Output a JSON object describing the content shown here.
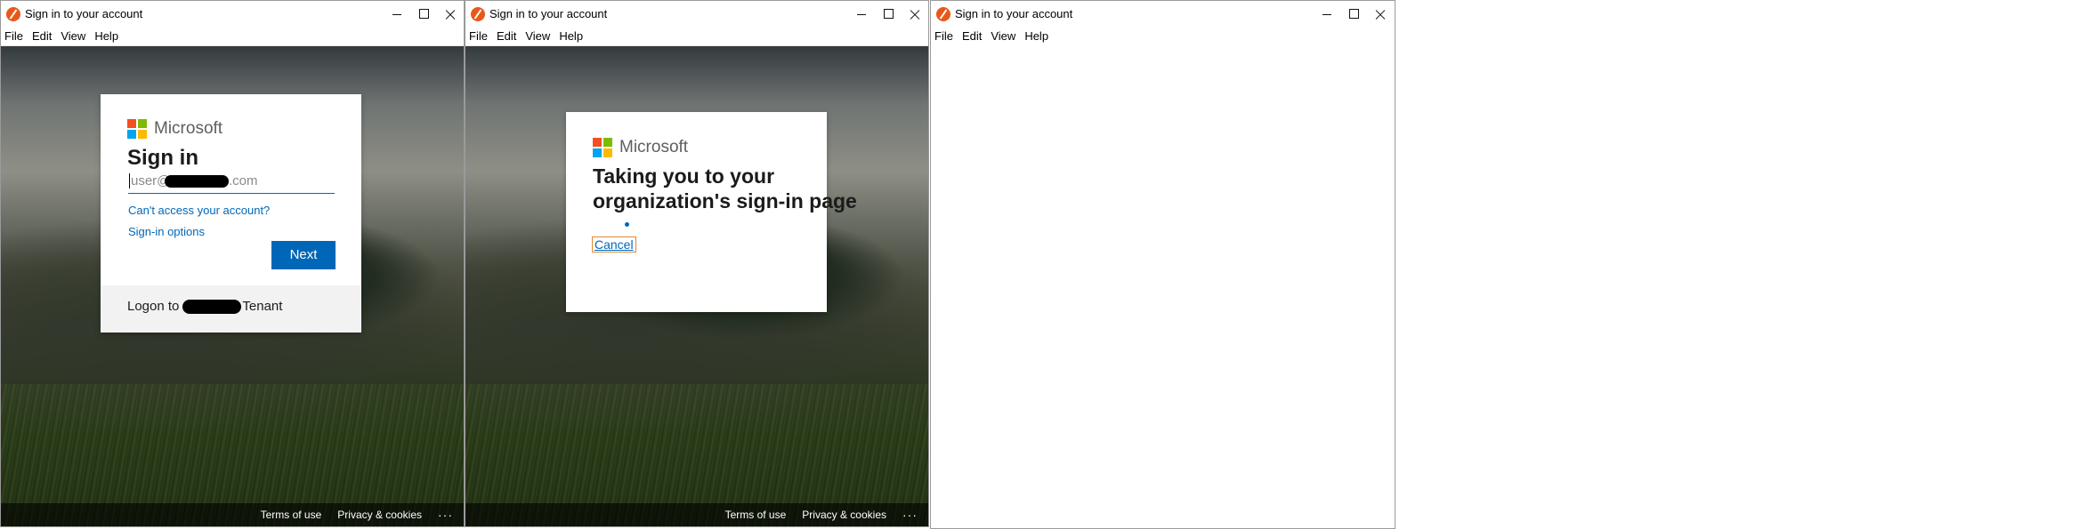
{
  "windows": [
    {
      "title": "Sign in to your account",
      "menu": [
        "File",
        "Edit",
        "View",
        "Help"
      ],
      "card": {
        "logo_text": "Microsoft",
        "heading": "Sign in",
        "email_placeholder_prefix": "user@",
        "email_placeholder_suffix": ".com",
        "cant_access_link": "Can't access your account?",
        "signin_options_link": "Sign-in options",
        "next_button": "Next",
        "footer_prefix": "Logon to",
        "footer_suffix": "Tenant"
      },
      "footer_links": {
        "terms": "Terms of use",
        "privacy": "Privacy & cookies",
        "more": "···"
      }
    },
    {
      "title": "Sign in to your account",
      "menu": [
        "File",
        "Edit",
        "View",
        "Help"
      ],
      "card": {
        "logo_text": "Microsoft",
        "heading": "Taking you to your organization's sign-in page",
        "cancel_button": "Cancel"
      },
      "footer_links": {
        "terms": "Terms of use",
        "privacy": "Privacy & cookies",
        "more": "···"
      }
    },
    {
      "title": "Sign in to your account",
      "menu": [
        "File",
        "Edit",
        "View",
        "Help"
      ]
    }
  ],
  "colors": {
    "accent_blue": "#0067b8",
    "ms_red": "#f25022",
    "ms_green": "#7fba00",
    "ms_blue": "#00a4ef",
    "ms_yellow": "#ffb900",
    "app_icon": "#e8581a"
  },
  "icons": {
    "app": "app-icon",
    "minimize": "minimize-icon",
    "maximize": "maximize-icon",
    "close": "close-icon"
  }
}
